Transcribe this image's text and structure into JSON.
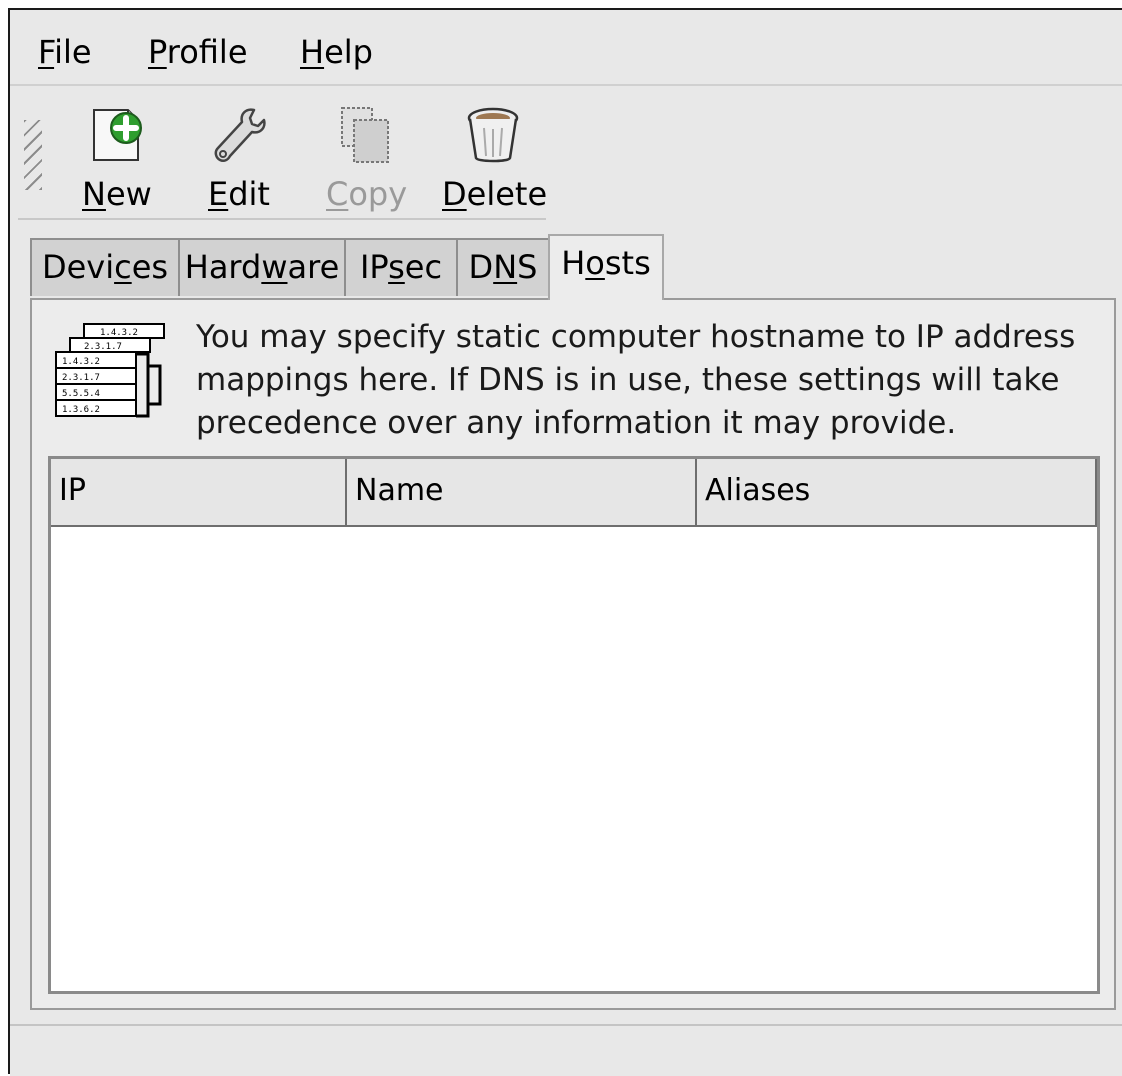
{
  "menubar": {
    "file": {
      "u": "F",
      "rest": "ile"
    },
    "profile": {
      "u": "P",
      "rest": "rofile"
    },
    "help": {
      "u": "H",
      "rest": "elp"
    }
  },
  "toolbar": {
    "new": {
      "u": "N",
      "rest": "ew",
      "icon": "new-document-icon"
    },
    "edit": {
      "u": "E",
      "rest": "dit",
      "icon": "wrench-icon"
    },
    "copy": {
      "u": "C",
      "rest": "opy",
      "icon": "copy-icon",
      "enabled": false
    },
    "delete": {
      "u": "D",
      "rest": "elete",
      "icon": "trash-icon"
    }
  },
  "tabs": {
    "devices": {
      "pre": "Devi",
      "u": "c",
      "post": "es"
    },
    "hardware": {
      "pre": "Hard",
      "u": "w",
      "post": "are"
    },
    "ipsec": {
      "pre": "IP",
      "u": "s",
      "post": "ec"
    },
    "dns": {
      "pre": "D",
      "u": "N",
      "post": "S"
    },
    "hosts": {
      "pre": "H",
      "u": "o",
      "post": "sts",
      "active": true
    }
  },
  "panel": {
    "icon": "host-list-icon",
    "icon_rows": [
      "1.4.3.2",
      "2.3.1.7",
      "1.4.3.2",
      "2.3.1.7",
      "5.5.5.4",
      "1.3.6.2"
    ],
    "description": "You may specify static computer hostname to IP address mappings here.  If DNS is in use, these settings will take precedence over any information it may provide."
  },
  "table": {
    "columns": [
      "IP",
      "Name",
      "Aliases"
    ],
    "rows": []
  },
  "statusbar": {
    "text": ""
  }
}
